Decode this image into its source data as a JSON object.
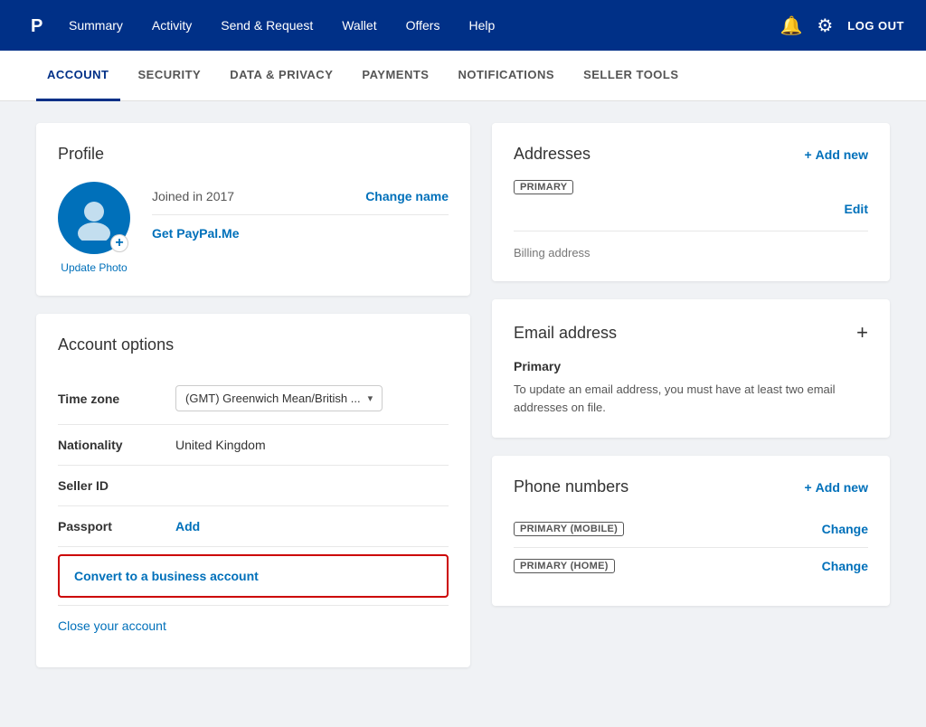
{
  "topNav": {
    "links": [
      {
        "id": "summary",
        "label": "Summary"
      },
      {
        "id": "activity",
        "label": "Activity"
      },
      {
        "id": "send-request",
        "label": "Send & Request"
      },
      {
        "id": "wallet",
        "label": "Wallet"
      },
      {
        "id": "offers",
        "label": "Offers"
      },
      {
        "id": "help",
        "label": "Help"
      }
    ],
    "logout_label": "LOG OUT"
  },
  "subNav": {
    "items": [
      {
        "id": "account",
        "label": "ACCOUNT",
        "active": true
      },
      {
        "id": "security",
        "label": "SECURITY",
        "active": false
      },
      {
        "id": "data-privacy",
        "label": "DATA & PRIVACY",
        "active": false
      },
      {
        "id": "payments",
        "label": "PAYMENTS",
        "active": false
      },
      {
        "id": "notifications",
        "label": "NOTIFICATIONS",
        "active": false
      },
      {
        "id": "seller-tools",
        "label": "SELLER TOOLS",
        "active": false
      }
    ]
  },
  "profile": {
    "title": "Profile",
    "joined_text": "Joined in 2017",
    "change_name_label": "Change name",
    "paypalme_label": "Get PayPal.Me",
    "update_photo_label": "Update Photo"
  },
  "accountOptions": {
    "title": "Account options",
    "rows": [
      {
        "label": "Time zone",
        "value": "(GMT) Greenwich Mean/British ...",
        "type": "dropdown"
      },
      {
        "label": "Nationality",
        "value": "United Kingdom",
        "type": "text"
      },
      {
        "label": "Seller ID",
        "value": "",
        "type": "text"
      },
      {
        "label": "Passport",
        "value": "",
        "action": "Add",
        "type": "action"
      }
    ],
    "convert_label": "Convert to a business account",
    "close_label": "Close your account"
  },
  "addresses": {
    "title": "Addresses",
    "add_new_label": "Add new",
    "badge_primary": "PRIMARY",
    "edit_label": "Edit",
    "billing_label": "Billing address"
  },
  "emailAddress": {
    "title": "Email address",
    "primary_label": "Primary",
    "note": "To update an email address, you must have at least two email addresses on file."
  },
  "phoneNumbers": {
    "title": "Phone numbers",
    "add_new_label": "Add new",
    "rows": [
      {
        "badge": "PRIMARY (MOBILE)",
        "change_label": "Change"
      },
      {
        "badge": "PRIMARY (HOME)",
        "change_label": "Change"
      }
    ]
  },
  "icons": {
    "bell": "🔔",
    "gear": "⚙",
    "plus": "+",
    "chevron_down": "▾"
  }
}
